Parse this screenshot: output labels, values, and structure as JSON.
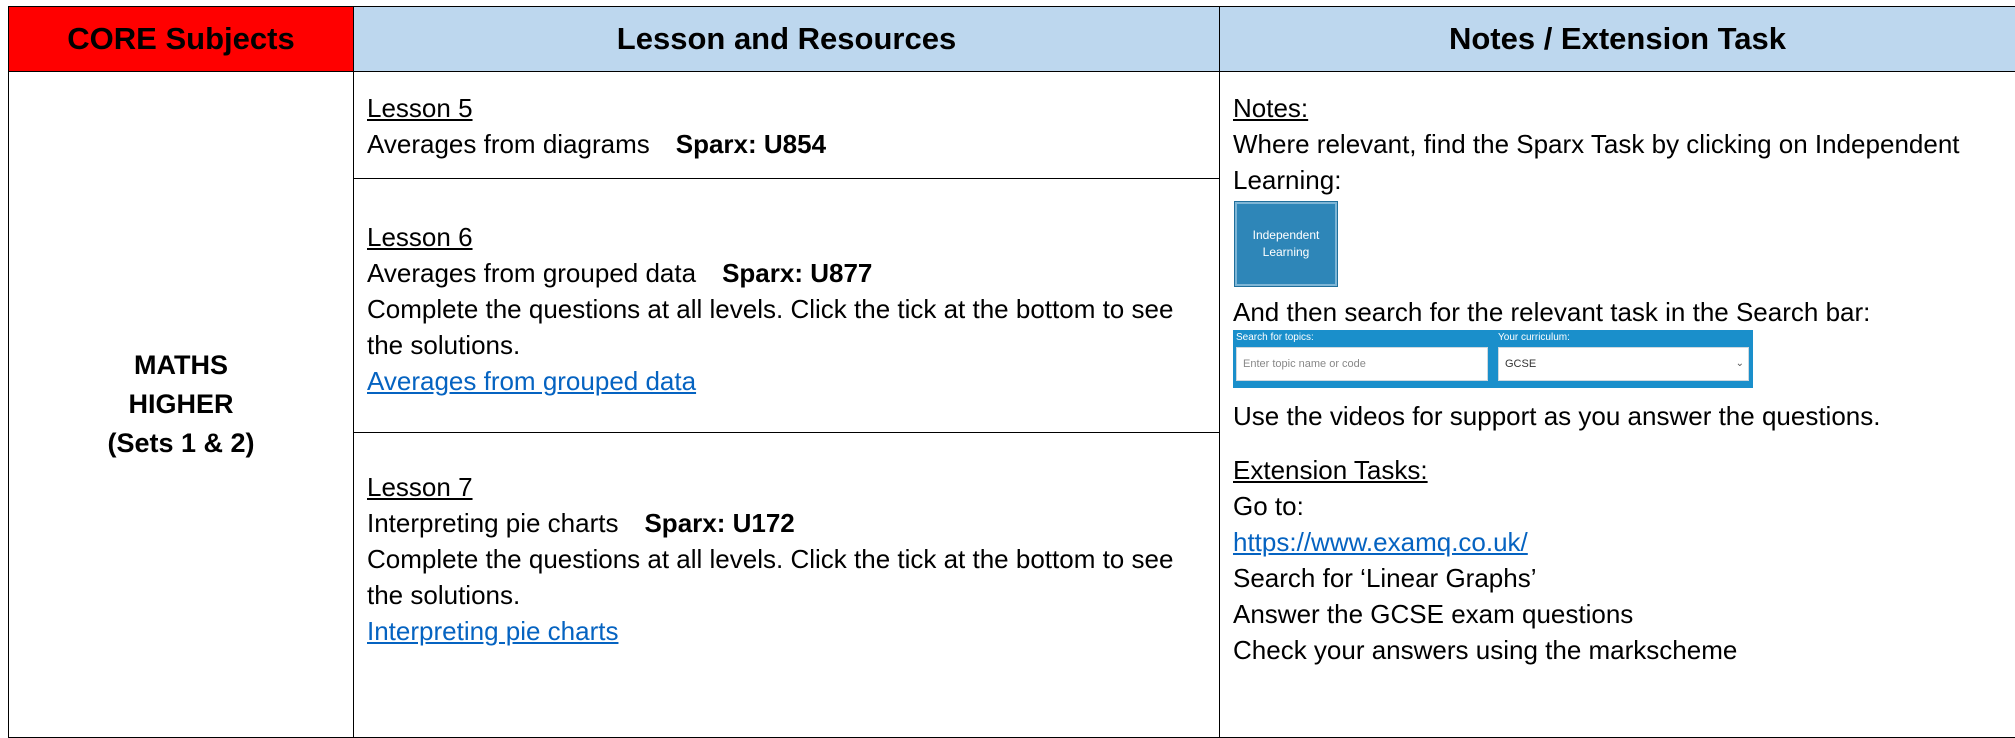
{
  "header": {
    "col1": "CORE Subjects",
    "col2": "Lesson and Resources",
    "col3": "Notes / Extension Task"
  },
  "subject": {
    "line1": "MATHS",
    "line2": "HIGHER",
    "line3": "(Sets 1 & 2)"
  },
  "lessons": [
    {
      "title": "Lesson 5",
      "topic": "Averages from diagrams",
      "sparx": "Sparx: U854"
    },
    {
      "title": "Lesson 6",
      "topic": "Averages from grouped data",
      "sparx": "Sparx: U877",
      "instruction": "Complete the questions at all levels. Click the tick at the bottom to see the solutions.",
      "link": "Averages from grouped data"
    },
    {
      "title": "Lesson 7",
      "topic": "Interpreting pie charts",
      "sparx": "Sparx: U172",
      "instruction": "Complete the questions at all levels. Click the tick at the bottom to see the solutions.",
      "link": "Interpreting pie charts"
    }
  ],
  "notes": {
    "heading": "Notes:",
    "text1": "Where relevant, find the Sparx Task by clicking on Independent Learning:",
    "button_line1": "Independent",
    "button_line2": "Learning",
    "text2": "And then search for the relevant task in the Search bar:",
    "search_label": "Search for topics:",
    "search_placeholder": "Enter topic name or code",
    "curriculum_label": "Your curriculum:",
    "curriculum_value": "GCSE",
    "text3": "Use the videos for support as you answer the questions.",
    "ext_heading": "Extension Tasks:",
    "ext_goto": "Go to:",
    "ext_link": "https://www.examq.co.uk/",
    "ext_search": "Search for ‘Linear Graphs’",
    "ext_answer": "Answer the GCSE exam questions",
    "ext_check": "Check your answers using the markscheme"
  },
  "colors": {
    "core_header": "#ff0000",
    "header_blue": "#bdd7ee",
    "link": "#0563c1",
    "sparx_blue": "#1a8fcb"
  }
}
